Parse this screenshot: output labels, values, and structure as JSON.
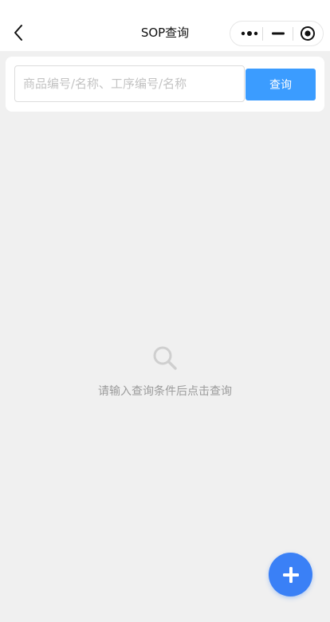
{
  "nav": {
    "title": "SOP查询",
    "back_icon": "chevron-left-icon",
    "capsule": {
      "more_icon": "more-dots-icon",
      "minimize_icon": "minimize-icon",
      "close_icon": "target-close-icon"
    }
  },
  "search": {
    "placeholder": "商品编号/名称、工序编号/名称",
    "value": "",
    "button_label": "查询"
  },
  "empty_state": {
    "icon": "search-icon",
    "message": "请输入查询条件后点击查询"
  },
  "fab": {
    "icon": "plus-icon"
  },
  "colors": {
    "primary": "#3b9cff",
    "fab": "#3a80f6",
    "background": "#f0f0f0",
    "muted_text": "#9b9b9b"
  }
}
